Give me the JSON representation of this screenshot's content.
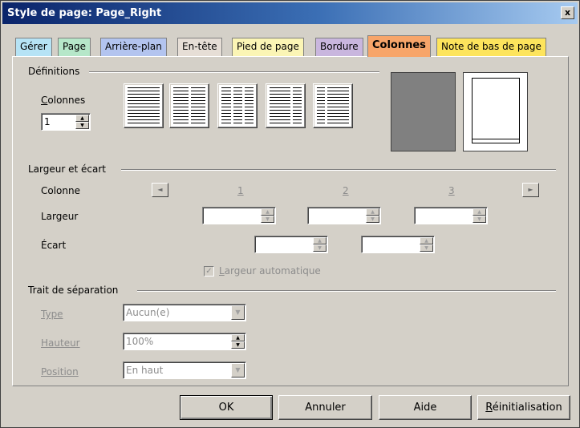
{
  "window": {
    "title": "Style de page: Page_Right",
    "close_label": "x"
  },
  "tabs": [
    {
      "label": "Gérer",
      "color": "#b6e3f5"
    },
    {
      "label": "Page",
      "color": "#b6e7c9"
    },
    {
      "label": "Arrière-plan",
      "color": "#b3c4ef"
    },
    {
      "label": "En-tête",
      "color": "#e6ded6"
    },
    {
      "label": "Pied de page",
      "color": "#fbf5b5"
    },
    {
      "label": "Bordure",
      "color": "#c9b6de"
    },
    {
      "label": "Colonnes",
      "color": "#f7a56a",
      "active": true
    },
    {
      "label": "Note de bas de page",
      "color": "#fde45c"
    }
  ],
  "definitions": {
    "section_title": "Définitions",
    "columns_label": "Colonnes",
    "columns_value": "1"
  },
  "width_spacing": {
    "section_title": "Largeur et écart",
    "column_label": "Colonne",
    "col1": "1",
    "col2": "2",
    "col3": "3",
    "width_label": "Largeur",
    "spacing_label": "Écart",
    "auto_width_label": "Largeur automatique",
    "auto_width_checked": true
  },
  "separator": {
    "section_title": "Trait de séparation",
    "type_label": "Type",
    "type_value": "Aucun(e)",
    "height_label": "Hauteur",
    "height_value": "100%",
    "position_label": "Position",
    "position_value": "En haut"
  },
  "buttons": {
    "ok": "OK",
    "cancel": "Annuler",
    "help": "Aide",
    "reset": "Réinitialisation"
  },
  "icons": {
    "left_arrow": "◄",
    "right_arrow": "►",
    "spin_up": "▲",
    "spin_down": "▼",
    "dropdown": "▼",
    "check": "✓"
  }
}
